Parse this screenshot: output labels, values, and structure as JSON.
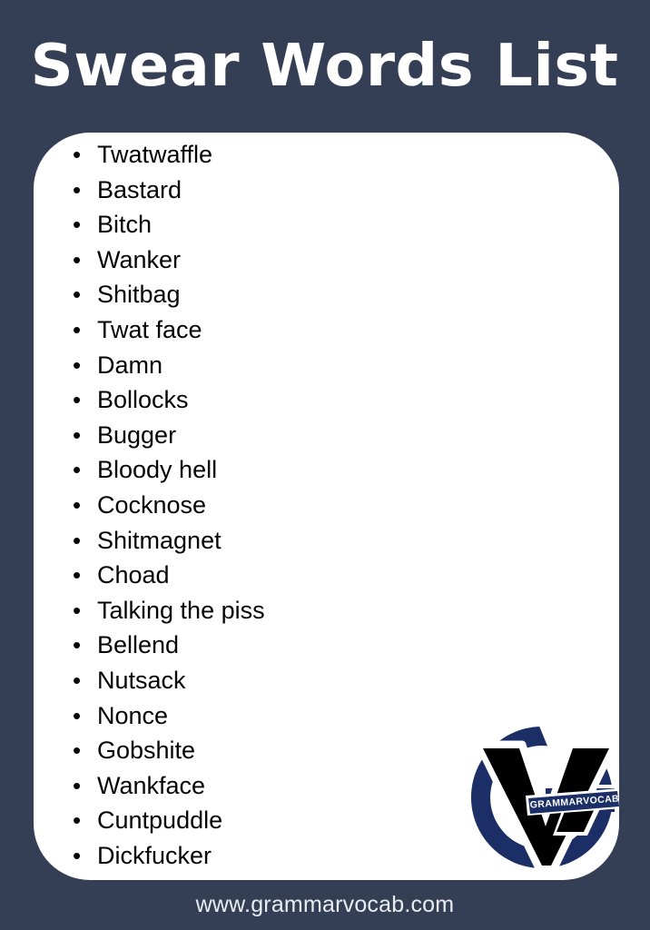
{
  "page": {
    "background_color": "#343f55",
    "card_color": "#ffffff"
  },
  "header": {
    "title": "Swear Words List",
    "title_color": "#ffffff"
  },
  "list": {
    "bullet_glyph": "•",
    "items": [
      "Twatwaffle",
      "Bastard",
      "Bitch",
      "Wanker",
      "Shitbag",
      "Twat face",
      "Damn",
      "Bollocks",
      "Bugger",
      "Bloody hell",
      "Cocknose",
      "Shitmagnet",
      "Choad",
      "Talking the piss",
      "Bellend",
      "Nutsack",
      "Nonce",
      "Gobshite",
      "Wankface",
      "Cuntpuddle",
      "Dickfucker"
    ]
  },
  "logo": {
    "name": "grammarvocab-logo",
    "wordmark": "GRAMMARVOCAB",
    "ring_color": "#1b2f66",
    "v_color": "#000000",
    "wordmark_color": "#ffffff"
  },
  "footer": {
    "url": "www.grammarvocab.com",
    "url_color": "#e9ecf1"
  }
}
